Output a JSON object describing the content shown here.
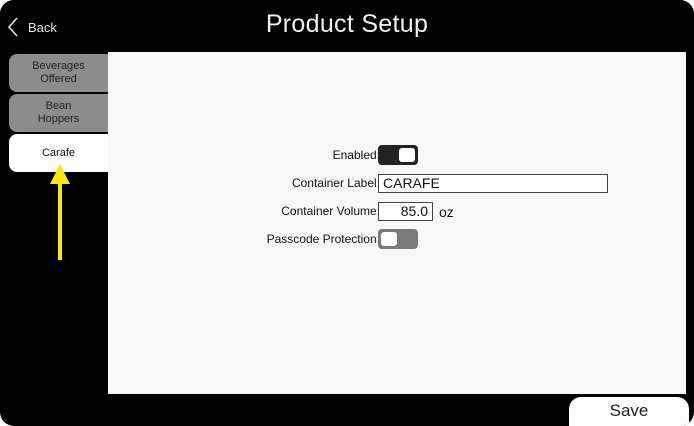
{
  "header": {
    "back_label": "Back",
    "title": "Product Setup"
  },
  "sidebar": {
    "tabs": [
      {
        "label": "Beverages Offered",
        "active": false
      },
      {
        "label": "Bean Hoppers",
        "active": false
      },
      {
        "label": "Carafe",
        "active": true
      }
    ]
  },
  "form": {
    "enabled_label": "Enabled:",
    "enabled_value": true,
    "container_label_label": "Container Label:",
    "container_label_value": "CARAFE",
    "container_volume_label": "Container Volume:",
    "container_volume_value": "85.0",
    "container_volume_unit": "oz",
    "passcode_label": "Passcode Protection:",
    "passcode_value": false
  },
  "footer": {
    "save_label": "Save"
  },
  "colors": {
    "annotation_arrow": "#ffe600",
    "inactive_tab": "#8c8c8c",
    "toggle_on": "#222222",
    "toggle_off": "#7a7a7a"
  }
}
